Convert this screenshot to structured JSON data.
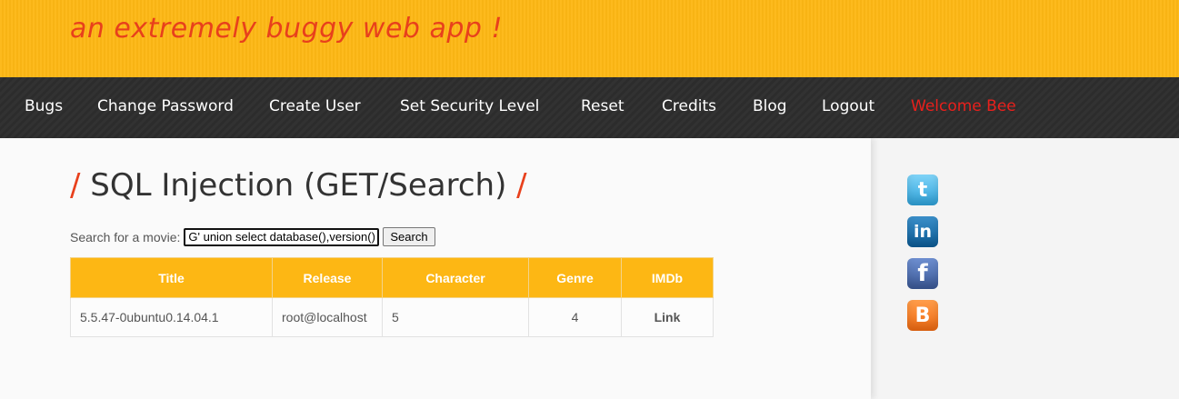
{
  "header": {
    "tagline": "an extremely buggy web app !"
  },
  "nav": {
    "items": [
      "Bugs",
      "Change Password",
      "Create User",
      "Set Security Level",
      "Reset",
      "Credits",
      "Blog",
      "Logout"
    ],
    "welcome": "Welcome Bee"
  },
  "page": {
    "title": "SQL Injection (GET/Search)",
    "slash": "/"
  },
  "search": {
    "label": "Search for a movie:",
    "value": "G' union select database(),version()",
    "button": "Search"
  },
  "table": {
    "headers": [
      "Title",
      "Release",
      "Character",
      "Genre",
      "IMDb"
    ],
    "rows": [
      [
        "5.5.47-0ubuntu0.14.04.1",
        "root@localhost",
        "5",
        "4",
        "Link"
      ]
    ]
  },
  "social": {
    "twitter": "twitter-icon",
    "linkedin": "linkedin-icon",
    "facebook": "facebook-icon",
    "blogger": "blogger-icon"
  },
  "colors": {
    "header_bg": "#fdb714",
    "accent": "#e8401c",
    "nav_bg": "#2e2e2e",
    "welcome": "#e8201c"
  }
}
